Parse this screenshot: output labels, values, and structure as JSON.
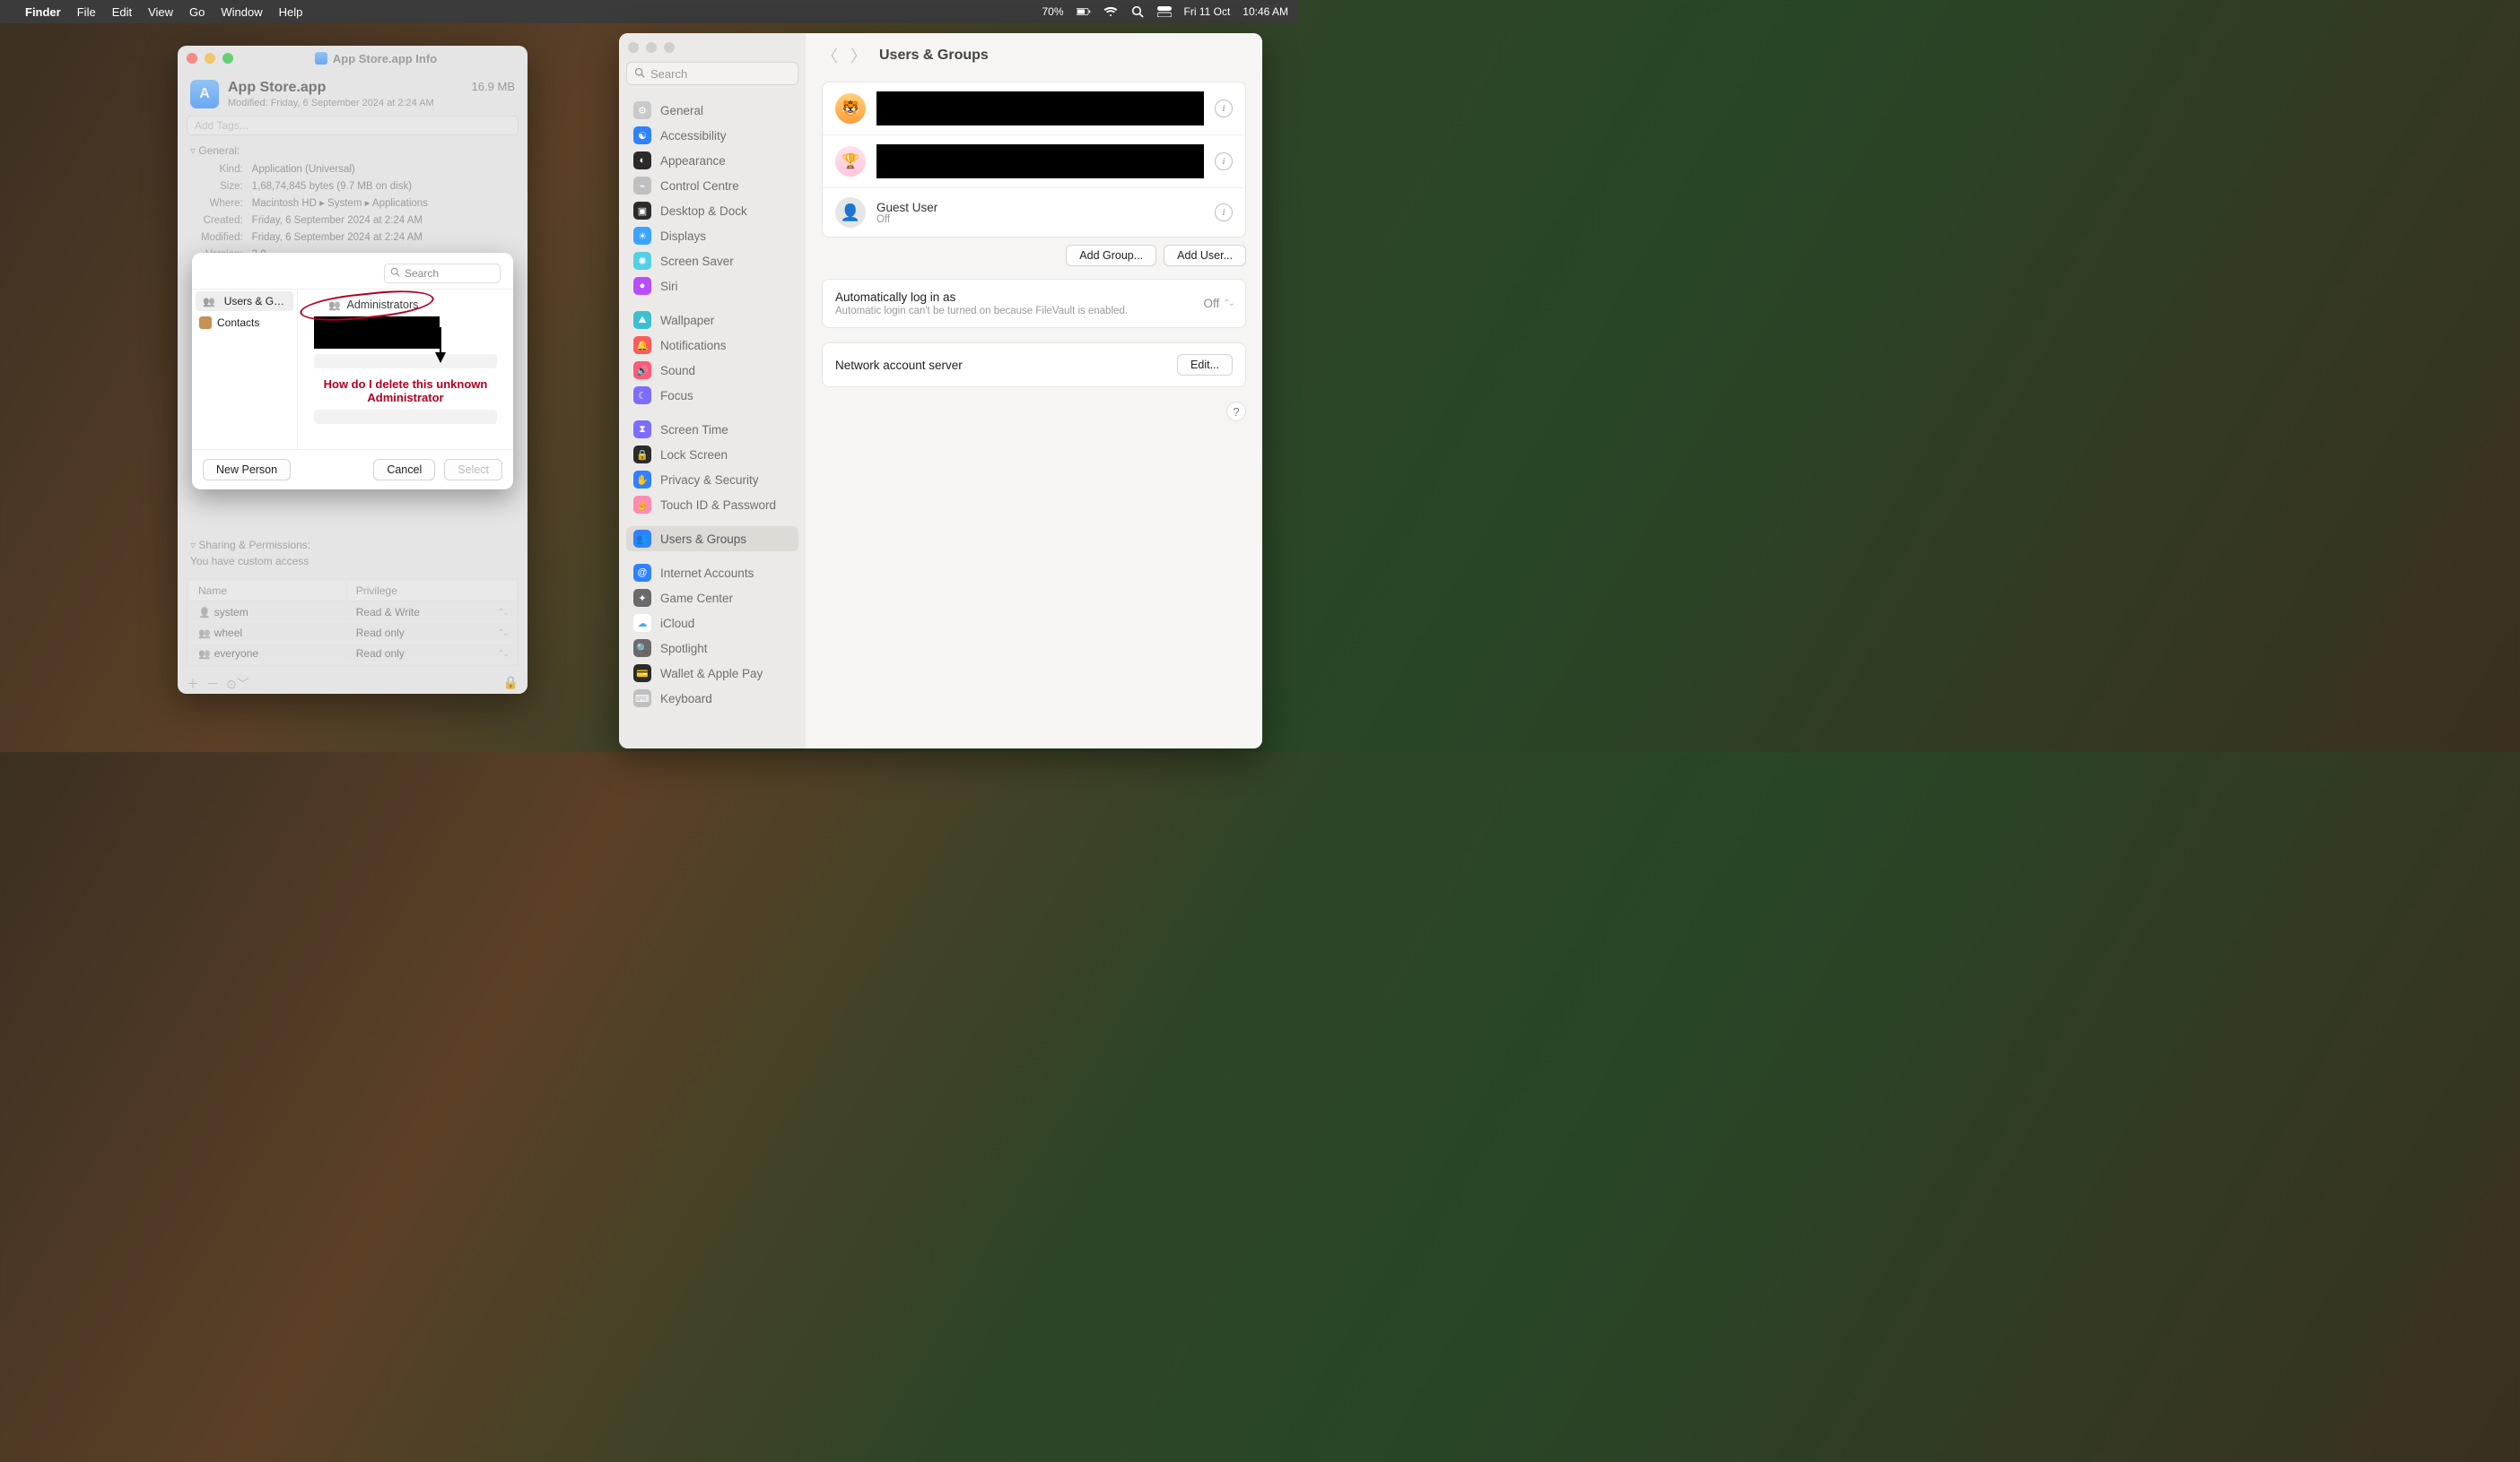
{
  "menubar": {
    "app": "Finder",
    "items": [
      "File",
      "Edit",
      "View",
      "Go",
      "Window",
      "Help"
    ],
    "battery_percent": "70%",
    "date": "Fri 11 Oct",
    "time": "10:46 AM"
  },
  "info_window": {
    "title": "App Store.app Info",
    "app_name": "App Store.app",
    "modified_line": "Modified: Friday, 6 September 2024 at 2:24 AM",
    "size_right": "16.9 MB",
    "tags_placeholder": "Add Tags...",
    "sections": {
      "general": "General:",
      "sharing": "Sharing & Permissions:"
    },
    "general": {
      "Kind": "Application (Universal)",
      "Size": "1,68,74,845 bytes (9.7 MB on disk)",
      "Where": "Macintosh HD ▸ System ▸ Applications",
      "Created": "Friday, 6 September 2024 at 2:24 AM",
      "Modified": "Friday, 6 September 2024 at 2:24 AM",
      "Version": "3.0"
    },
    "custom_access": "You have custom access",
    "perm_headers": [
      "Name",
      "Privilege"
    ],
    "perm_rows": [
      {
        "name": "system",
        "priv": "Read & Write",
        "icon": "single"
      },
      {
        "name": "wheel",
        "priv": "Read only",
        "icon": "group"
      },
      {
        "name": "everyone",
        "priv": "Read only",
        "icon": "group"
      }
    ]
  },
  "picker": {
    "search_placeholder": "Search",
    "sources": [
      {
        "label": "Users & G…",
        "selected": true
      },
      {
        "label": "Contacts",
        "selected": false
      }
    ],
    "group_label": "Administrators",
    "annotation": "How do I delete this unknown Administrator",
    "buttons": {
      "new": "New Person",
      "cancel": "Cancel",
      "select": "Select"
    }
  },
  "settings": {
    "title": "Users & Groups",
    "search_placeholder": "Search",
    "sidebar": [
      {
        "label": "General",
        "icon": "⚙︎",
        "bg": "#c9c9c9"
      },
      {
        "label": "Accessibility",
        "icon": "☯",
        "bg": "#2f82ff"
      },
      {
        "label": "Appearance",
        "icon": "◐",
        "bg": "#2b2b2b"
      },
      {
        "label": "Control Centre",
        "icon": "⌁",
        "bg": "#bfbfbf"
      },
      {
        "label": "Desktop & Dock",
        "icon": "▣",
        "bg": "#2b2b2b"
      },
      {
        "label": "Displays",
        "icon": "☀",
        "bg": "#3aa4ff"
      },
      {
        "label": "Screen Saver",
        "icon": "✺",
        "bg": "#55cfe6"
      },
      {
        "label": "Siri",
        "icon": "●",
        "bg": "#b84cff"
      },
      {
        "label": "Wallpaper",
        "icon": "⛰",
        "bg": "#3ac1d0"
      },
      {
        "label": "Notifications",
        "icon": "🔔",
        "bg": "#ff5a5a"
      },
      {
        "label": "Sound",
        "icon": "🔊",
        "bg": "#ff5a78"
      },
      {
        "label": "Focus",
        "icon": "☾",
        "bg": "#7d6cff"
      },
      {
        "label": "Screen Time",
        "icon": "⧗",
        "bg": "#7d6cff"
      },
      {
        "label": "Lock Screen",
        "icon": "🔒",
        "bg": "#2b2b2b"
      },
      {
        "label": "Privacy & Security",
        "icon": "✋",
        "bg": "#2f82ff"
      },
      {
        "label": "Touch ID & Password",
        "icon": "☝",
        "bg": "#ff8bb5"
      },
      {
        "label": "Users & Groups",
        "icon": "👥",
        "bg": "#2f82ff",
        "selected": true
      },
      {
        "label": "Internet Accounts",
        "icon": "@",
        "bg": "#2f82ff"
      },
      {
        "label": "Game Center",
        "icon": "✦",
        "bg": "#6a6a6a"
      },
      {
        "label": "iCloud",
        "icon": "☁",
        "bg": "#ffffff",
        "fg": "#4aa6ff"
      },
      {
        "label": "Spotlight",
        "icon": "🔍",
        "bg": "#6a6a6a"
      },
      {
        "label": "Wallet & Apple Pay",
        "icon": "💳",
        "bg": "#2b2b2b"
      },
      {
        "label": "Keyboard",
        "icon": "⌨",
        "bg": "#bfbfbf"
      }
    ],
    "guest": {
      "name": "Guest User",
      "sub": "Off"
    },
    "buttons": {
      "add_group": "Add Group...",
      "add_user": "Add User...",
      "edit": "Edit..."
    },
    "autologin": {
      "label": "Automatically log in as",
      "value": "Off",
      "note": "Automatic login can't be turned on because FileVault is enabled."
    },
    "network_server": "Network account server"
  }
}
